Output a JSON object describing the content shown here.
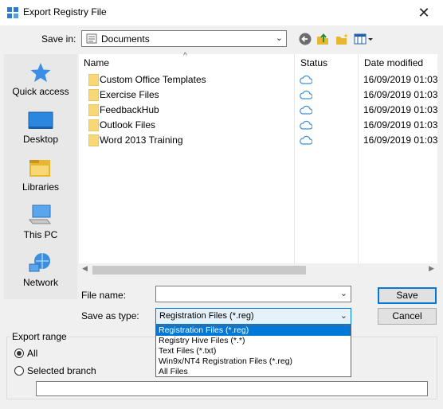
{
  "window": {
    "title": "Export Registry File",
    "close_glyph": "✕"
  },
  "toolbar": {
    "save_in_label": "Save in:",
    "save_in_value": "Documents",
    "icons": [
      "back-icon",
      "up-folder-icon",
      "new-folder-icon",
      "view-menu-icon"
    ]
  },
  "places": [
    {
      "label": "Quick access",
      "icon": "quick-access-star-icon"
    },
    {
      "label": "Desktop",
      "icon": "desktop-icon"
    },
    {
      "label": "Libraries",
      "icon": "libraries-icon"
    },
    {
      "label": "This PC",
      "icon": "this-pc-icon"
    },
    {
      "label": "Network",
      "icon": "network-icon"
    }
  ],
  "columns": {
    "name": "Name",
    "status": "Status",
    "date": "Date modified"
  },
  "files": [
    {
      "name": "Custom Office Templates",
      "date": "16/09/2019 01:03"
    },
    {
      "name": "Exercise Files",
      "date": "16/09/2019 01:03"
    },
    {
      "name": "FeedbackHub",
      "date": "16/09/2019 01:03"
    },
    {
      "name": "Outlook Files",
      "date": "16/09/2019 01:03"
    },
    {
      "name": "Word 2013 Training",
      "date": "16/09/2019 01:03"
    }
  ],
  "form": {
    "file_name_label": "File name:",
    "file_name_value": "",
    "save_as_type_label": "Save as type:",
    "save_as_type_value": "Registration Files (*.reg)",
    "save_button": "Save",
    "cancel_button": "Cancel"
  },
  "type_options": [
    "Registration Files (*.reg)",
    "Registry Hive Files (*.*)",
    "Text Files (*.txt)",
    "Win9x/NT4 Registration Files (*.reg)",
    "All Files"
  ],
  "export_range": {
    "legend": "Export range",
    "all_label": "All",
    "branch_label": "Selected branch",
    "branch_value": ""
  },
  "colors": {
    "accent": "#0078d7",
    "folder": "#f8d775",
    "cloud": "#3a8fd8"
  }
}
